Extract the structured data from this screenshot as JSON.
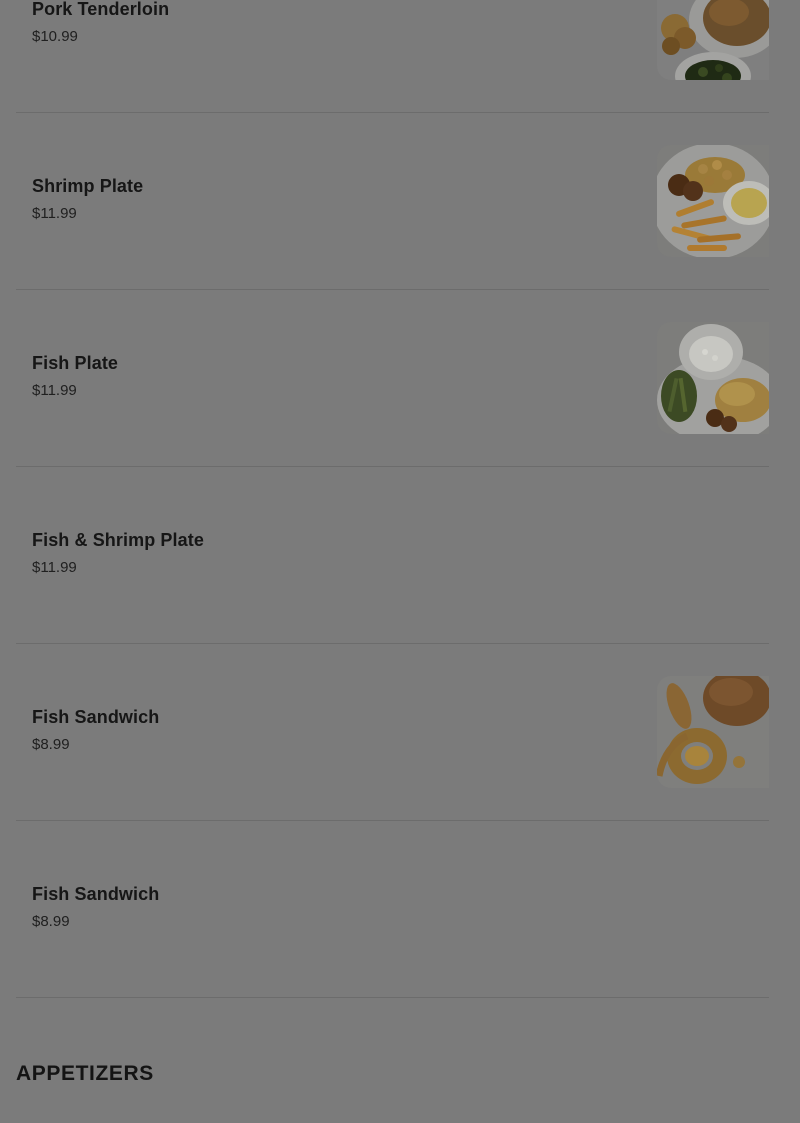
{
  "menu": {
    "items": [
      {
        "name": "Pork Tenderloin",
        "price": "$10.99",
        "image": "pork-tenderloin-photo"
      },
      {
        "name": "Shrimp Plate",
        "price": "$11.99",
        "image": "shrimp-plate-photo"
      },
      {
        "name": "Fish Plate",
        "price": "$11.99",
        "image": "fish-plate-photo"
      },
      {
        "name": "Fish & Shrimp Plate",
        "price": "$11.99",
        "image": ""
      },
      {
        "name": "Fish Sandwich",
        "price": "$8.99",
        "image": "fish-sandwich-photo"
      },
      {
        "name": "Fish Sandwich",
        "price": "$8.99",
        "image": ""
      }
    ]
  },
  "next_section": {
    "title": "APPETIZERS"
  }
}
